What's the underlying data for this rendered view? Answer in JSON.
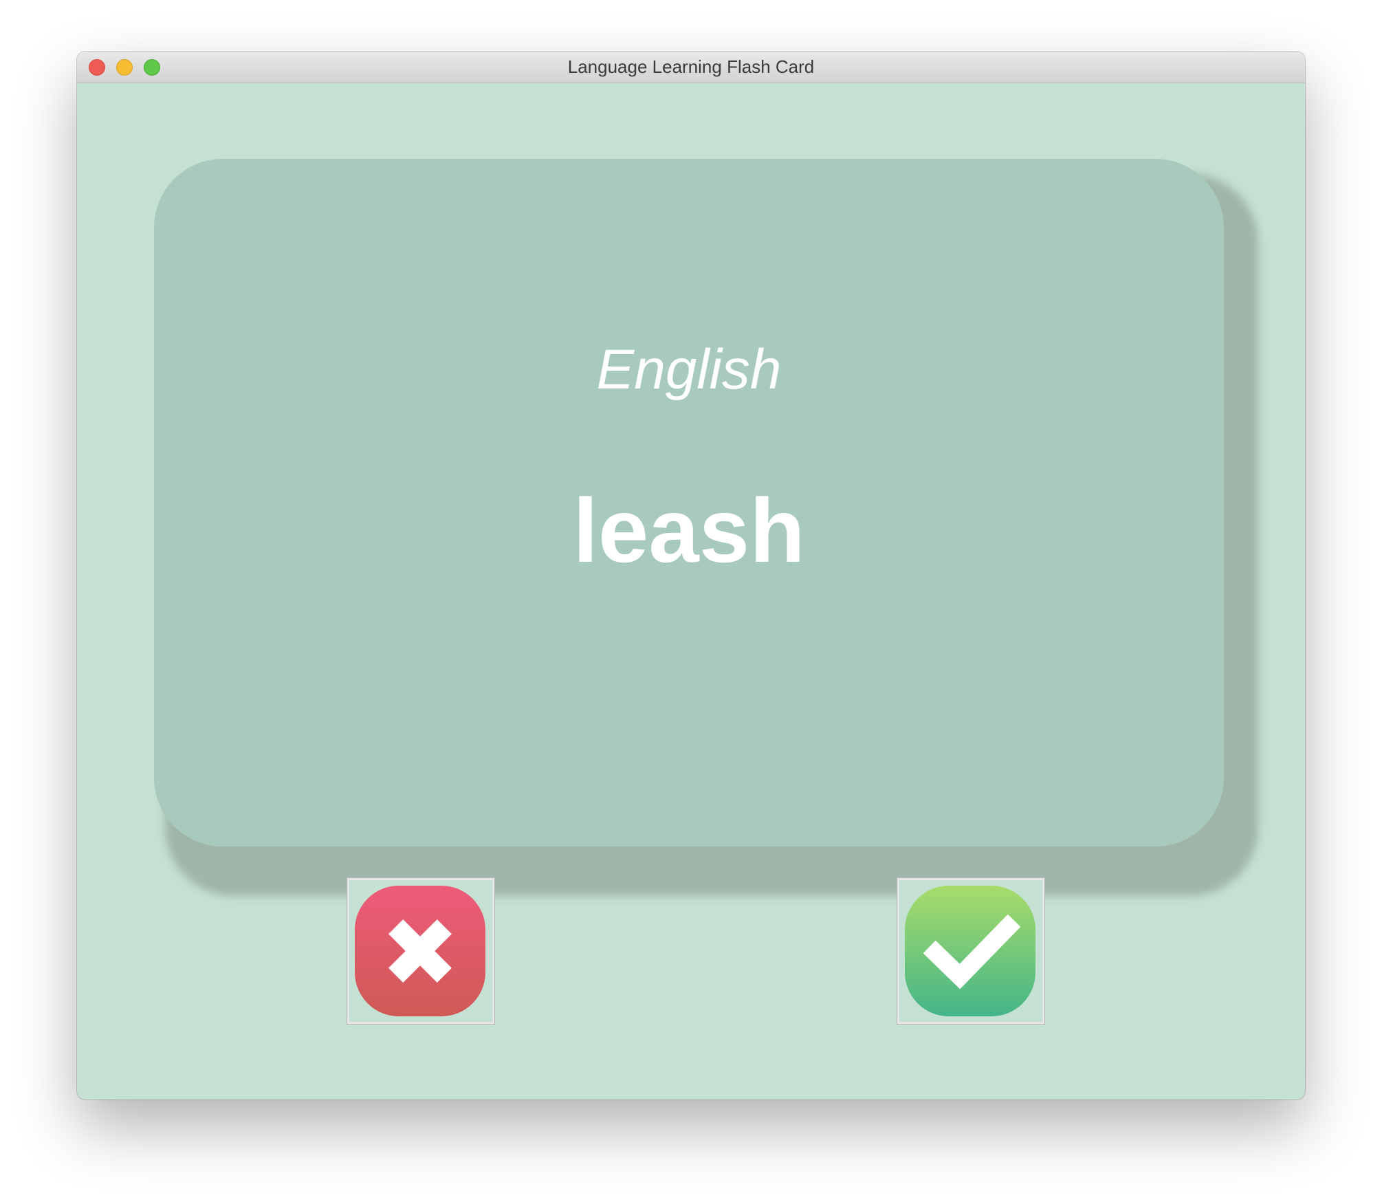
{
  "window": {
    "title": "Language Learning Flash Card",
    "background_color": "#c5e1d3"
  },
  "card": {
    "language": "English",
    "word": "leash",
    "color": "#a8cabd"
  },
  "buttons": {
    "wrong": {
      "icon": "x-icon",
      "color": "#e05a66"
    },
    "right": {
      "icon": "checkmark-icon",
      "color": "#5fc37b"
    }
  }
}
